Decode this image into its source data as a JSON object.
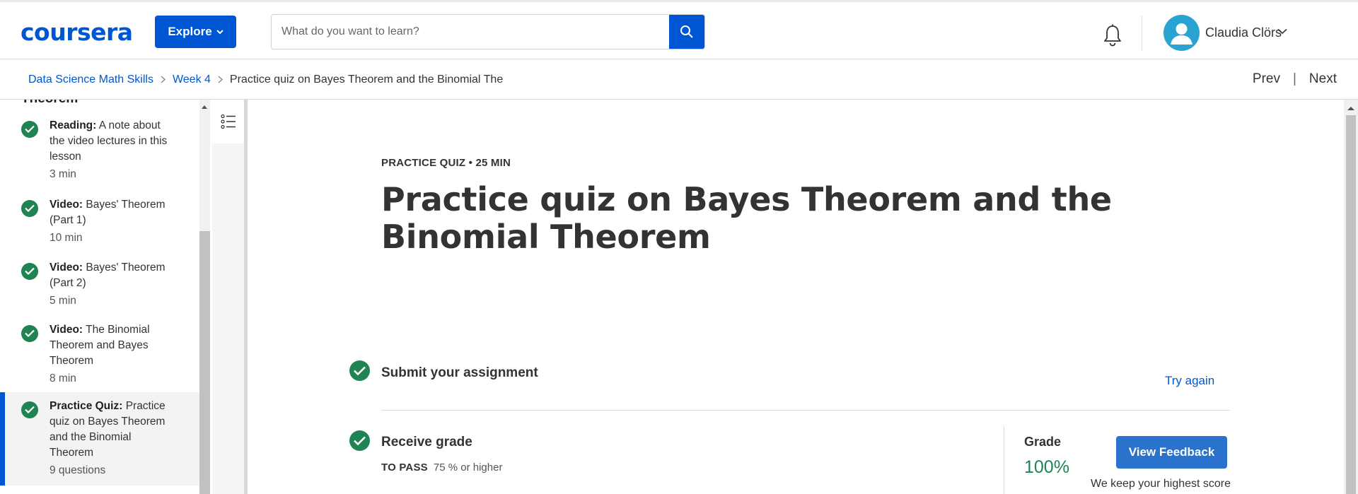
{
  "header": {
    "logo": "coursera",
    "explore_label": "Explore",
    "search_placeholder": "What do you want to learn?",
    "user_name": "Claudia Clörs",
    "icons": [
      "search-icon",
      "bell-icon",
      "avatar-icon",
      "chevron-down-icon"
    ],
    "accent_color": "#0056d2"
  },
  "breadcrumb": {
    "items": [
      "Data Science Math Skills",
      "Week 4"
    ],
    "current": "Practice quiz on Bayes Theorem and the Binomial The",
    "prev_label": "Prev",
    "separator": "|",
    "next_label": "Next"
  },
  "sidebar": {
    "section_cut_text": "Theorem",
    "items": [
      {
        "type": "Reading:",
        "title": "A note about the video lectures in this lesson",
        "meta": "3 min",
        "completed": true
      },
      {
        "type": "Video:",
        "title": "Bayes' Theorem (Part 1)",
        "meta": "10 min",
        "completed": true
      },
      {
        "type": "Video:",
        "title": "Bayes' Theorem (Part 2)",
        "meta": "5 min",
        "completed": true
      },
      {
        "type": "Video:",
        "title": "The Binomial Theorem and Bayes Theorem",
        "meta": "8 min",
        "completed": true
      },
      {
        "type": "Practice Quiz:",
        "title": "Practice quiz on Bayes Theorem and the Binomial Theorem",
        "meta": "9 questions",
        "completed": true,
        "active": true
      }
    ]
  },
  "main": {
    "kicker": "PRACTICE QUIZ • 25 MIN",
    "title": "Practice quiz on Bayes Theorem and the Binomial Theorem",
    "submit": {
      "title": "Submit your assignment",
      "action": "Try again"
    },
    "grade": {
      "title": "Receive grade",
      "to_pass_label": "TO PASS",
      "to_pass_value": "75 % or higher",
      "grade_label": "Grade",
      "grade_value": "100%",
      "feedback_button": "View Feedback",
      "note": "We keep your highest score"
    },
    "success_color": "#1f8354"
  }
}
